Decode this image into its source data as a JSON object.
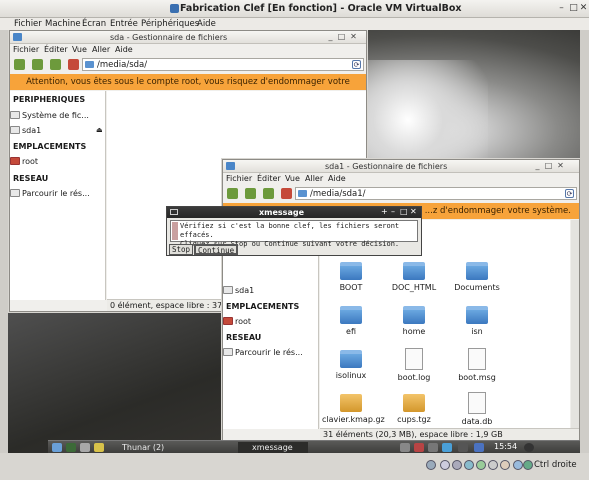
{
  "vbox": {
    "title": "Fabrication Clef [En fonction] - Oracle VM VirtualBox",
    "menu": [
      "Fichier",
      "Machine",
      "Écran",
      "Entrée",
      "Périphériques",
      "Aide"
    ],
    "host_key": "Ctrl droite"
  },
  "thunar_sda": {
    "title": "sda - Gestionnaire de fichiers",
    "menu": [
      "Fichier",
      "Éditer",
      "Vue",
      "Aller",
      "Aide"
    ],
    "path": "/media/sda/",
    "warning": "Attention, vous êtes sous le compte root, vous risquez d'endommager votre système.",
    "sidebar": {
      "devices_header": "PERIPHERIQUES",
      "devices": [
        "Système de fic...",
        "sda1"
      ],
      "places_header": "EMPLACEMENTS",
      "places": [
        "root"
      ],
      "network_header": "RESEAU",
      "network": [
        "Parcourir le rés..."
      ]
    },
    "status": "0 élément, espace libre : 374,0"
  },
  "thunar_sda1": {
    "title": "sda1 - Gestionnaire de fichiers",
    "menu": [
      "Fichier",
      "Éditer",
      "Vue",
      "Aller",
      "Aide"
    ],
    "path": "/media/sda1/",
    "warning": "...z d'endommager votre système.",
    "sidebar": {
      "devices": [
        "sda1"
      ],
      "places_header": "EMPLACEMENTS",
      "places": [
        "root"
      ],
      "network_header": "RESEAU",
      "network": [
        "Parcourir le rés..."
      ]
    },
    "files": [
      "BOOT",
      "DOC_HTML",
      "Documents",
      "efi",
      "home",
      "isn",
      "isolinux",
      "boot.log",
      "boot.msg",
      "clavier.kmap.gz",
      "cups.tgz",
      "data.db"
    ],
    "status": "31 éléments (20,3 MB), espace libre : 1,9 GB"
  },
  "xmessage": {
    "title": "xmessage",
    "line1": "Vérifiez si c'est la bonne clef, les fichiers seront effacés.",
    "line2": "Cliquez sur Stop ou Continue suivant votre décision.",
    "stop": "Stop",
    "continue": "Continue"
  },
  "taskbar": {
    "tasks": [
      "Thunar (2)",
      "xmessage"
    ],
    "clock": "15:54"
  }
}
